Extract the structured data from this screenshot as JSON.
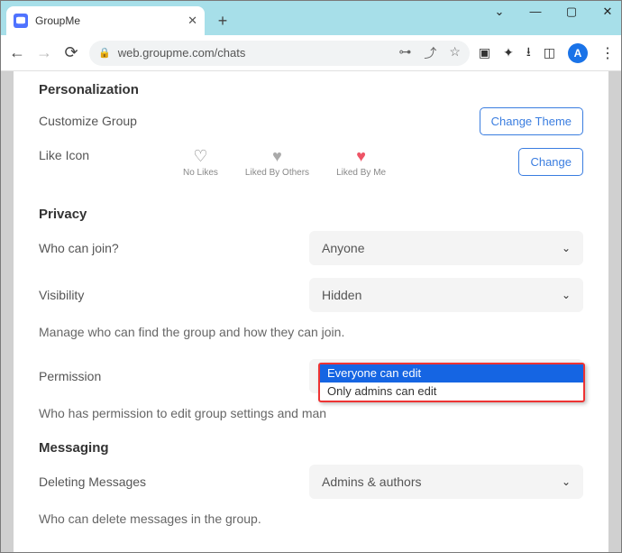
{
  "browser": {
    "tab_title": "GroupMe",
    "url": "web.groupme.com/chats",
    "avatar_letter": "A"
  },
  "sections": {
    "personalization": {
      "title": "Personalization",
      "customize_label": "Customize Group",
      "change_theme_btn": "Change Theme",
      "like_icon_label": "Like Icon",
      "change_btn": "Change",
      "likes": {
        "none": "No Likes",
        "others": "Liked By Others",
        "me": "Liked By Me"
      }
    },
    "privacy": {
      "title": "Privacy",
      "who_join_label": "Who can join?",
      "who_join_value": "Anyone",
      "visibility_label": "Visibility",
      "visibility_value": "Hidden",
      "manage_desc": "Manage who can find the group and how they can join.",
      "permission_label": "Permission",
      "permission_value": "Everyone can edit",
      "permission_options": [
        "Everyone can edit",
        "Only admins can edit"
      ],
      "permission_desc": "Who has permission to edit group settings and man"
    },
    "messaging": {
      "title": "Messaging",
      "delete_label": "Deleting Messages",
      "delete_value": "Admins & authors",
      "delete_desc": "Who can delete messages in the group."
    }
  }
}
